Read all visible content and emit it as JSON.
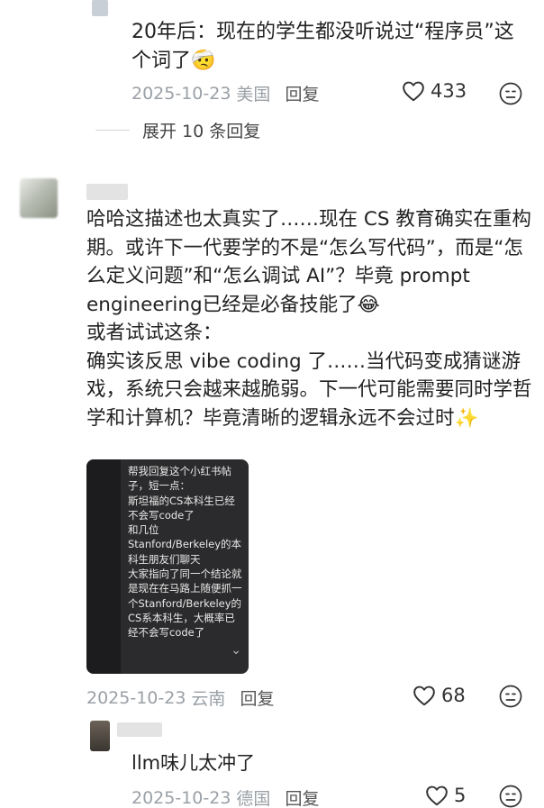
{
  "comment1": {
    "text": "20年后：现在的学生都没听说过“程序员”这个词了🤕",
    "date": "2025-10-23",
    "location": "美国",
    "reply_label": "回复",
    "likes": "433"
  },
  "expand": {
    "label": "展开 10 条回复"
  },
  "comment2": {
    "paragraphs": [
      "哈哈这描述也太真实了……现在 CS 教育确实在重构期。或许下一代要学的不是“怎么写代码”，而是“怎么定义问题”和“怎么调试 AI”？毕竟 prompt engineering已经是必备技能了😂",
      "或者试试这条：",
      "确实该反思 vibe coding 了……当代码变成猜谜游戏，系统只会越来越脆弱。下一代可能需要同时学哲学和计算机？毕竟清晰的逻辑永远不会过时✨"
    ],
    "image_text": "帮我回复这个小红书帖子，短一点：\n斯坦福的CS本科生已经不会写code了\n和几位Stanford/Berkeley的本科生朋友们聊天\n大家指向了同一个结论就是现在在马路上随便抓一个Stanford/Berkeley的CS系本科生，大概率已经不会写code了",
    "date": "2025-10-23",
    "location": "云南",
    "reply_label": "回复",
    "likes": "68"
  },
  "comment3": {
    "text": "llm味儿太冲了",
    "date": "2025-10-23",
    "location": "德国",
    "reply_label": "回复",
    "likes": "5"
  }
}
